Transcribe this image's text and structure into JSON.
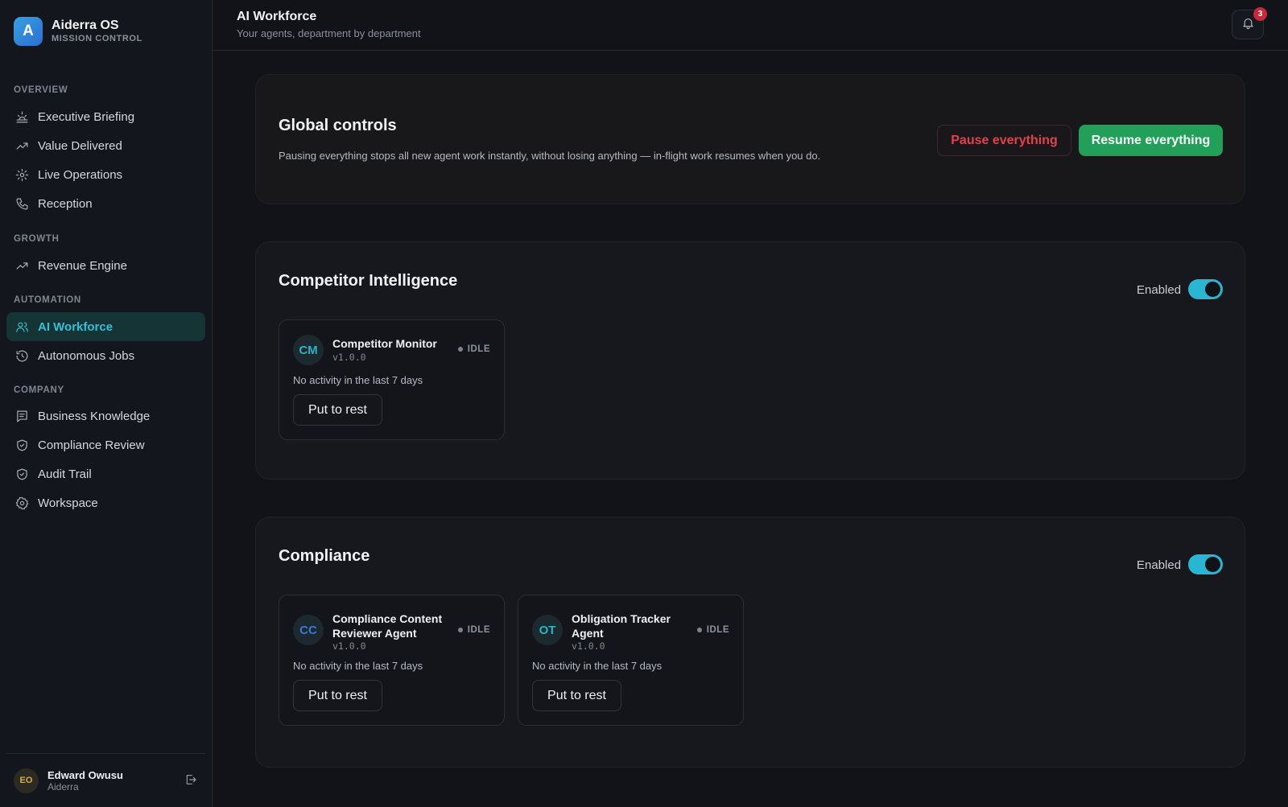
{
  "brand": {
    "logo_letter": "A",
    "name": "Aiderra OS",
    "subtitle": "MISSION CONTROL"
  },
  "sidebar": {
    "sections": [
      {
        "label": "OVERVIEW"
      },
      {
        "label": "GROWTH"
      },
      {
        "label": "AUTOMATION"
      },
      {
        "label": "COMPANY"
      }
    ],
    "items": [
      {
        "label": "Executive Briefing",
        "icon": "sunrise-icon"
      },
      {
        "label": "Value Delivered",
        "icon": "trend-up-icon"
      },
      {
        "label": "Live Operations",
        "icon": "activity-sun-icon"
      },
      {
        "label": "Reception",
        "icon": "phone-icon"
      },
      {
        "label": "Revenue Engine",
        "icon": "trend-up-icon"
      },
      {
        "label": "AI Workforce",
        "icon": "users-icon",
        "active": true
      },
      {
        "label": "Autonomous Jobs",
        "icon": "history-icon"
      },
      {
        "label": "Business Knowledge",
        "icon": "document-icon"
      },
      {
        "label": "Compliance Review",
        "icon": "shield-check-icon"
      },
      {
        "label": "Audit Trail",
        "icon": "shield-check-icon"
      },
      {
        "label": "Workspace",
        "icon": "gear-icon"
      }
    ]
  },
  "user": {
    "initials": "EO",
    "name": "Edward Owusu",
    "org": "Aiderra"
  },
  "header": {
    "title": "AI Workforce",
    "subtitle": "Your agents, department by department",
    "notification_count": "3"
  },
  "global_controls": {
    "title": "Global controls",
    "description": "Pausing everything stops all new agent work instantly, without losing anything — in-flight work resumes when you do.",
    "pause_label": "Pause everything",
    "resume_label": "Resume everything"
  },
  "departments": [
    {
      "name": "Competitor Intelligence",
      "toggle_label": "Enabled",
      "enabled": true,
      "agents": [
        {
          "initials": "CM",
          "name": "Competitor Monitor",
          "version": "v1.0.0",
          "status": "IDLE",
          "activity": "No activity in the last 7 days",
          "action": "Put to rest",
          "color": "#2bb3c9"
        }
      ]
    },
    {
      "name": "Compliance",
      "toggle_label": "Enabled",
      "enabled": true,
      "agents": [
        {
          "initials": "CC",
          "name": "Compliance Content Reviewer Agent",
          "version": "v1.0.0",
          "status": "IDLE",
          "activity": "No activity in the last 7 days",
          "action": "Put to rest",
          "color": "#3a78d4"
        },
        {
          "initials": "OT",
          "name": "Obligation Tracker Agent",
          "version": "v1.0.0",
          "status": "IDLE",
          "activity": "No activity in the last 7 days",
          "action": "Put to rest",
          "color": "#2bb3c9"
        }
      ]
    }
  ],
  "colors": {
    "accent": "#34c0d6",
    "resume": "#22a05a",
    "pause": "#e0434e",
    "badge": "#c9283a"
  }
}
